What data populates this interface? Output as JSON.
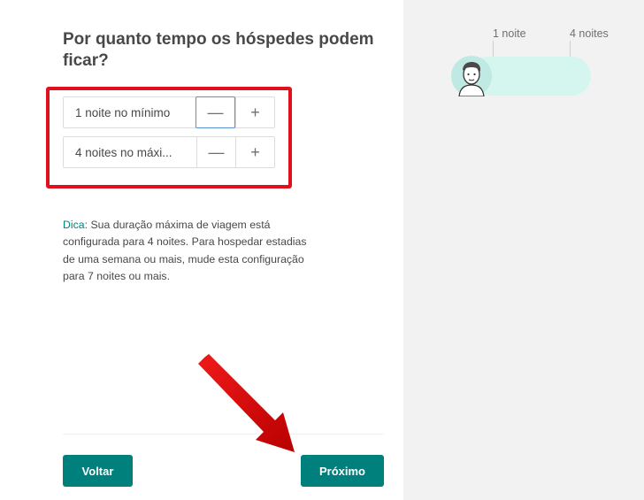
{
  "form": {
    "title": "Por quanto tempo os hóspedes podem ficar?",
    "min_stepper": {
      "label": "1 noite no mínimo",
      "decrement": "—",
      "increment": "+"
    },
    "max_stepper": {
      "label": "4 noites no máxi...",
      "decrement": "—",
      "increment": "+"
    },
    "tip": {
      "strong": "Dica:",
      "text": " Sua duração máxima de viagem está configurada para 4 noites. Para hospedar estadias de uma semana ou mais, mude esta configuração para 7 noites ou mais."
    }
  },
  "footer": {
    "back_label": "Voltar",
    "next_label": "Próximo"
  },
  "preview": {
    "min_label": "1 noite",
    "max_label": "4 noites",
    "avatar_icon": "person-avatar-icon"
  },
  "colors": {
    "accent": "#00807d",
    "highlight": "#e0101e",
    "range_fill": "#d4f6ef",
    "panel_bg": "#f2f2f2"
  }
}
